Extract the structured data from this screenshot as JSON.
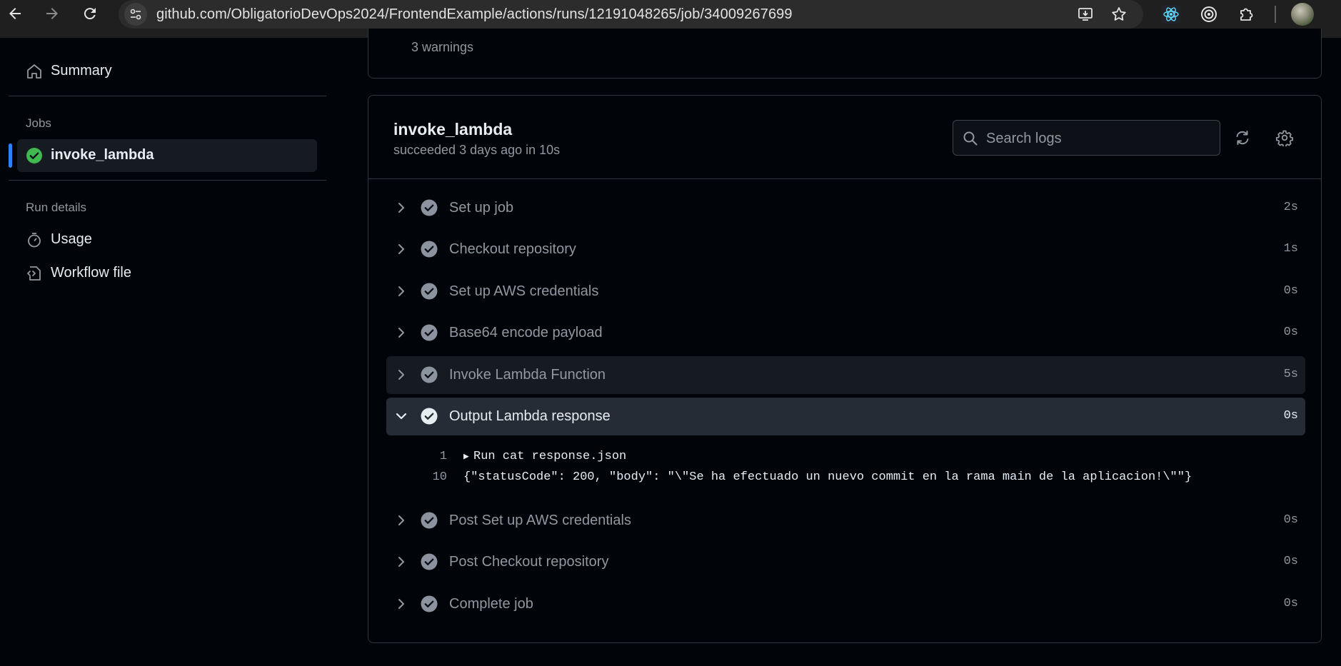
{
  "browser": {
    "url": "github.com/ObligatorioDevOps2024/FrontendExample/actions/runs/12191048265/job/34009267699"
  },
  "sidebar": {
    "summary_label": "Summary",
    "jobs_heading": "Jobs",
    "job_label": "invoke_lambda",
    "run_details_heading": "Run details",
    "usage_label": "Usage",
    "workflow_file_label": "Workflow file"
  },
  "top_card": {
    "warnings": "3 warnings"
  },
  "job": {
    "title": "invoke_lambda",
    "subtitle": "succeeded 3 days ago in 10s",
    "search_placeholder": "Search logs"
  },
  "steps": [
    {
      "name": "Set up job",
      "duration": "2s"
    },
    {
      "name": "Checkout repository",
      "duration": "1s"
    },
    {
      "name": "Set up AWS credentials",
      "duration": "0s"
    },
    {
      "name": "Base64 encode payload",
      "duration": "0s"
    },
    {
      "name": "Invoke Lambda Function",
      "duration": "5s"
    },
    {
      "name": "Output Lambda response",
      "duration": "0s"
    },
    {
      "name": "Post Set up AWS credentials",
      "duration": "0s"
    },
    {
      "name": "Post Checkout repository",
      "duration": "0s"
    },
    {
      "name": "Complete job",
      "duration": "0s"
    }
  ],
  "log_lines": [
    {
      "number": "1",
      "text": "Run cat response.json"
    },
    {
      "number": "10",
      "text": "{\"statusCode\": 200, \"body\": \"\\\"Se ha efectuado un nuevo commit en la rama main de la aplicacion!\\\"\"}"
    }
  ],
  "colors": {
    "success": "#3fb950",
    "accent": "#2f81f7",
    "muted_check": "#8b949e"
  }
}
